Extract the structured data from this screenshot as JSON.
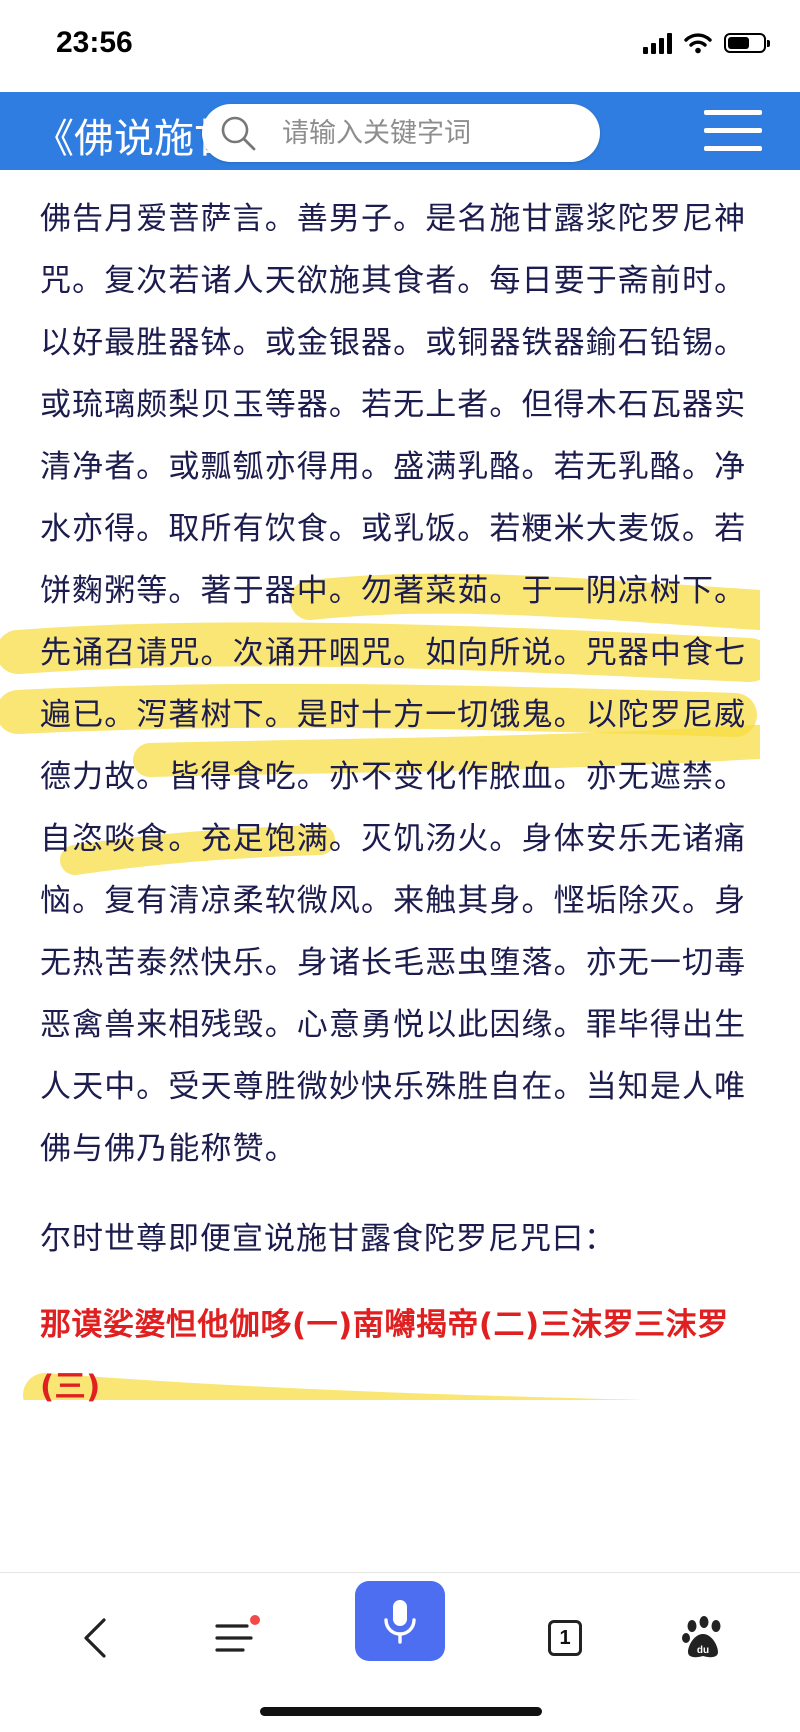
{
  "status_bar": {
    "time": "23:56"
  },
  "header": {
    "title": "《佛说施甘露食陀罗尼经》",
    "search_placeholder": "请输入关键字词"
  },
  "content": {
    "paragraph": "佛告月爱菩萨言。善男子。是名施甘露浆陀罗尼神咒。复次若诸人天欲施其食者。每日要于斋前时。以好最胜器钵。或金银器。或铜器铁器鍮石铅锡。或琉璃颇梨贝玉等器。若无上者。但得木石瓦器实清净者。或瓢瓠亦得用。盛满乳酪。若无乳酪。净水亦得。取所有饮食。或乳饭。若粳米大麦饭。若饼麴粥等。著于器中。勿著菜茹。于一阴凉树下。先诵召请咒。次诵开咽咒。如向所说。咒器中食七遍已。泻著树下。是时十方一切饿鬼。以陀罗尼威德力故。皆得食吃。亦不变化作脓血。亦无遮禁。自恣啖食。充足饱满。灭饥汤火。身体安乐无诸痛恼。复有清凉柔软微风。来触其身。悭垢除灭。身无热苦泰然快乐。身诸长毛恶虫堕落。亦无一切毒恶禽兽来相残毁。心意勇悦以此因缘。罪毕得出生人天中。受天尊胜微妙快乐殊胜自在。当知是人唯佛与佛乃能称赞。",
    "mantra_prompt": "尔时世尊即便宣说施甘露食陀罗尼咒曰：",
    "mantra": "那谟娑婆怛他伽哆(一)南嚩揭帝(二)三沫罗三沫罗(三)"
  },
  "bottom_nav": {
    "tab_count": "1"
  },
  "colors": {
    "header_bg": "#2f7de1",
    "body_text": "#1c1c4e",
    "mantra_text": "#e02020",
    "highlight": "#f7dc3e",
    "mic_button": "#4e6ef2"
  }
}
